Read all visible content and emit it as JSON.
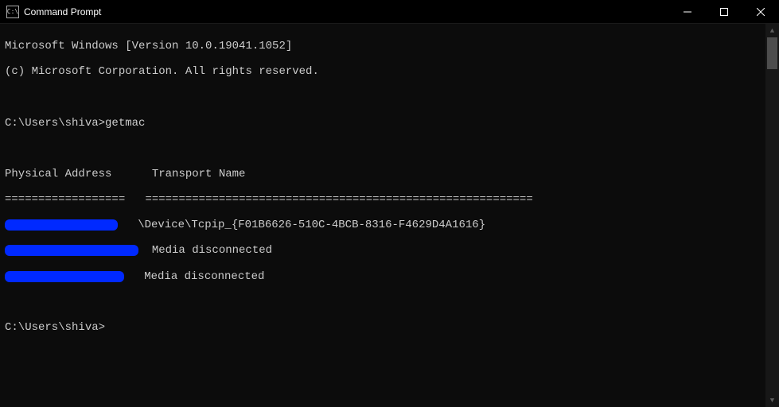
{
  "titlebar": {
    "icon_label": "C:\\",
    "title": "Command Prompt"
  },
  "terminal": {
    "banner_line1": "Microsoft Windows [Version 10.0.19041.1052]",
    "banner_line2": "(c) Microsoft Corporation. All rights reserved.",
    "prompt1_path": "C:\\Users\\shiva>",
    "prompt1_cmd": "getmac",
    "header_phys": "Physical Address",
    "header_transport": "Transport Name",
    "rule_phys": "==================",
    "rule_transport": "==========================================================",
    "row1_transport": "\\Device\\Tcpip_{F01B6626-510C-4BCB-8316-F4629D4A1616}",
    "row2_transport": "Media disconnected",
    "row3_transport": "Media disconnected",
    "prompt2_path": "C:\\Users\\shiva>",
    "gap3": "   ",
    "gap6": "      ",
    "gap_tn1": "   ",
    "gap_tn2": "  ",
    "gap_tn3": "   "
  }
}
